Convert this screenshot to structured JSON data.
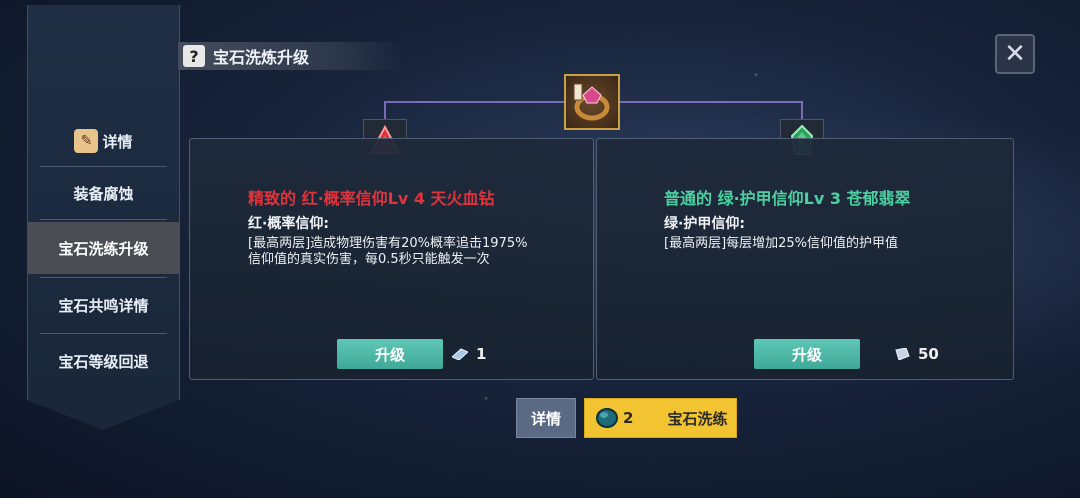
{
  "sidebar": {
    "items": [
      {
        "label": "详情",
        "icon": "scroll-icon"
      },
      {
        "label": "装备腐蚀"
      },
      {
        "label": "宝石洗练升级",
        "active": true
      },
      {
        "label": "宝石共鸣详情"
      },
      {
        "label": "宝石等级回退"
      }
    ]
  },
  "header": {
    "title": "宝石洗炼升级",
    "help_icon": "question-icon",
    "close_icon": "close-icon"
  },
  "colors": {
    "red_gem": "#d8323a",
    "green_gem": "#4dd0a0",
    "accent_button": "#4fb8a8",
    "refine_button": "#f3c431"
  },
  "left_panel": {
    "title": "精致的 红·概率信仰Lv 4 天火血钻",
    "subtitle": "红·概率信仰:",
    "description": "[最高两层]造成物理伤害有20%概率追击1975%信仰值的真实伤害，每0.5秒只能触发一次",
    "button_label": "升级",
    "cost": "1"
  },
  "right_panel": {
    "title": "普通的 绿·护甲信仰Lv 3 苍郁翡翠",
    "subtitle": "绿·护甲信仰:",
    "description": "[最高两层]每层增加25%信仰值的护甲值",
    "button_label": "升级",
    "cost": "50"
  },
  "bottom": {
    "detail_label": "详情",
    "refine_count": "2",
    "refine_label": "宝石洗练"
  }
}
